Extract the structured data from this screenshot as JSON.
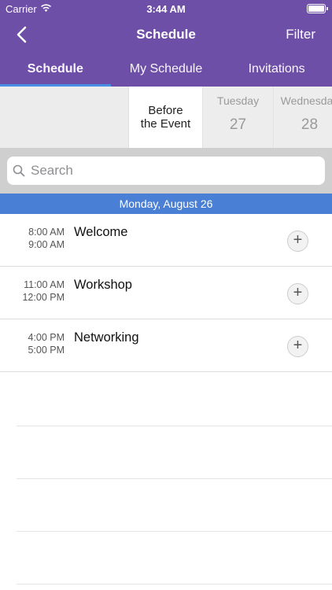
{
  "status": {
    "carrier": "Carrier",
    "time": "3:44 AM"
  },
  "nav": {
    "title": "Schedule",
    "filter_label": "Filter"
  },
  "tabs": [
    {
      "label": "Schedule",
      "active": true
    },
    {
      "label": "My Schedule",
      "active": false
    },
    {
      "label": "Invitations",
      "active": false
    }
  ],
  "dates": [
    {
      "line1": "Before",
      "line2": "the Event",
      "selected": true
    },
    {
      "day": "Tuesday",
      "num": "27"
    },
    {
      "day": "Wednesday",
      "num": "28"
    }
  ],
  "search": {
    "placeholder": "Search"
  },
  "day_header": "Monday, August 26",
  "sessions": [
    {
      "start": "8:00 AM",
      "end": "9:00 AM",
      "title": "Welcome"
    },
    {
      "start": "11:00 AM",
      "end": "12:00 PM",
      "title": "Workshop"
    },
    {
      "start": "4:00 PM",
      "end": "5:00 PM",
      "title": "Networking"
    }
  ],
  "add_symbol": "+",
  "colors": {
    "header": "#6e4fa8",
    "accent": "#4a7fd6"
  }
}
